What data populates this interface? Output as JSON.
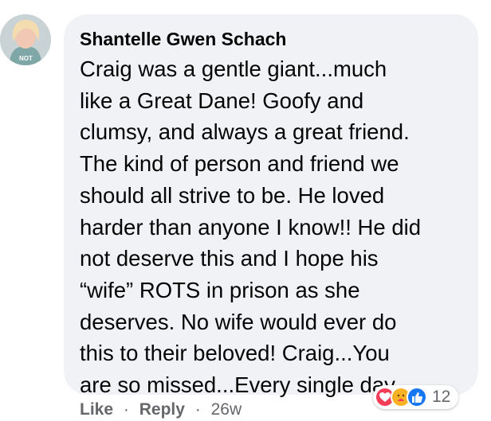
{
  "comment": {
    "author": "Shantelle Gwen Schach",
    "lines": [
      "Craig was a gentle giant...much",
      "like a Great Dane! Goofy and",
      "clumsy, and always a great friend.",
      "The kind of person and friend we",
      "should all strive to be. He loved",
      "harder than anyone I know!! He did",
      "not deserve this and I hope his",
      "“wife” ROTS in prison as she",
      "deserves. No wife would ever do",
      "this to their beloved! Craig...You",
      "are so missed...Every single day."
    ]
  },
  "reactions": {
    "icons": [
      "love-icon",
      "care-icon",
      "like-icon"
    ],
    "count": "12"
  },
  "actions": {
    "like_label": "Like",
    "separator": "·",
    "reply_label": "Reply",
    "timestamp": "26w"
  },
  "colors": {
    "bubble": "#f0f2f5",
    "text": "#050505",
    "secondary_text": "#65676b",
    "love": "#f33e58",
    "care": "#f7b125",
    "like": "#1877f2"
  }
}
